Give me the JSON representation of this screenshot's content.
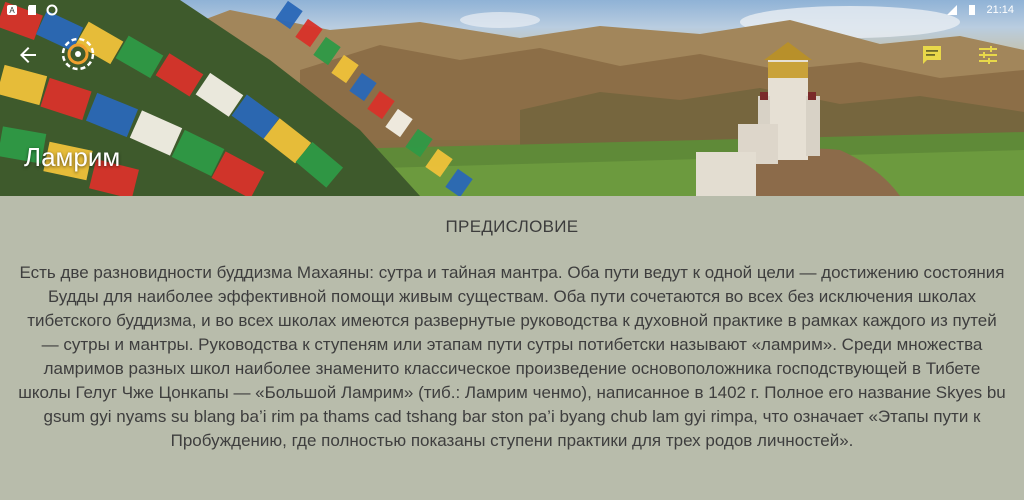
{
  "status_bar": {
    "time": "21:14",
    "icons_left": [
      "notification-a-icon",
      "sd-card-icon",
      "sync-icon"
    ],
    "icons_right": [
      "signal-icon",
      "battery-icon"
    ]
  },
  "app_bar": {
    "title": "Ламрим",
    "back_icon": "arrow-back-icon",
    "logo_icon": "dharma-wheel-logo",
    "actions": [
      "notes-icon",
      "tune-icon"
    ]
  },
  "content": {
    "heading": "ПРЕДИСЛОВИЕ",
    "paragraph": "Есть две разновидности буддизма Махаяны: сутра и тайная мантра. Оба пути ведут к одной цели — достижению состояния Будды для наиболее эффективной помощи живым существам. Оба пути сочетаются во всех без исключения школах тибетского буддизма, и во всех школах имеются развернутые руководства к духовной практике в рамках каждого из путей — сутры и мантры. Руководства к ступеням или этапам пути сутры потибетски называют «ламрим». Среди множества ламримов разных школ наиболее знаменито классическое произведение основоположника господствующей в Тибете школы Гелуг Чже Цонкапы — «Большой Ламрим» (тиб.: Ламрим ченмо), написанное в 1402 г. Полное его название Skyes bu gsum gyi nyams su blang ba’i rim pa thams cad tshang bar ston pa’i byang chub lam gyi rimpa, что означает «Этапы пути к Пробуждению, где полностью показаны ступени практики для трех родов личностей»."
  },
  "colors": {
    "content_background": "#b8bcab",
    "text": "#3e3e3e",
    "app_bar_icons": "#ffffff",
    "action_icons": "#e8d84a"
  }
}
